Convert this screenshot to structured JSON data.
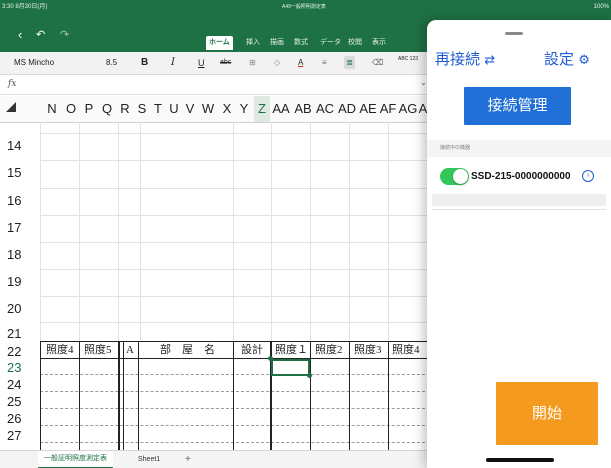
{
  "status_bar": {
    "date": "3:30 8月30日(月)",
    "doc_title": "A49一般照明測定表",
    "battery": "100%"
  },
  "ribbon": {
    "undo_icon": "undo-icon",
    "redo_icon": "redo-icon",
    "back_icon": "back-chevron-icon",
    "tabs": [
      "ホーム",
      "挿入",
      "描画",
      "数式",
      "データ",
      "校閲",
      "表示"
    ]
  },
  "toolbar": {
    "font_name": "MS Mincho",
    "font_size": "8.5",
    "bold": "B",
    "italic": "I",
    "underline": "U",
    "strikethrough": "abc",
    "font_color": "A",
    "number_format": "ABC 123"
  },
  "formula_bar": {
    "fx_label": "fx",
    "dropdown_icon": "chevron-down-icon"
  },
  "sheet": {
    "columns": [
      "N",
      "O",
      "P",
      "Q",
      "R",
      "S",
      "T",
      "U",
      "V",
      "W",
      "X",
      "Y",
      "Z",
      "AA",
      "AB",
      "AC",
      "AD",
      "AE",
      "AF",
      "AG",
      "A"
    ],
    "selected_column": "Z",
    "rows_top": [
      "14",
      "15",
      "16",
      "17",
      "18",
      "19",
      "20",
      "21"
    ],
    "rows_bottom": [
      "22",
      "23",
      "24",
      "25",
      "26",
      "27"
    ],
    "selected_row": "23",
    "row22_cells": [
      "照度4",
      "照度5",
      "A",
      "部　屋　名",
      "設計",
      "照度１",
      "照度2",
      "照度3",
      "照度4"
    ]
  },
  "sheet_tabs": {
    "tabs": [
      "一般証明照度測定表",
      "Sheet1"
    ],
    "add_label": "+"
  },
  "panel": {
    "reconnect_label": "再接続",
    "settings_label": "設定",
    "manage_label": "接続管理",
    "section_label": "接続中の機器",
    "device_name": "SSD-215-0000000000",
    "device_toggle_on": true,
    "start_label": "開始",
    "colors": {
      "link_blue": "#1f5bd1",
      "manage_blue": "#1f6fd6",
      "start_orange": "#f39a1f",
      "toggle_green": "#34c759",
      "excel_green": "#1e7145"
    }
  }
}
